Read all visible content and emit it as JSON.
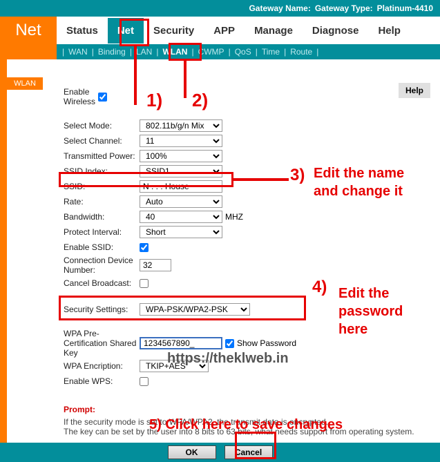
{
  "header": {
    "gateway_name_lbl": "Gateway Name:",
    "gateway_type_lbl": "Gateway Type:",
    "gateway_type_val": "Platinum-4410"
  },
  "brand": "Net",
  "tabs": [
    "Status",
    "Net",
    "Security",
    "APP",
    "Manage",
    "Diagnose",
    "Help"
  ],
  "active_tab": 1,
  "subnav": [
    "WAN",
    "Binding",
    "LAN",
    "WLAN",
    "CWMP",
    "QoS",
    "Time",
    "Route"
  ],
  "active_sub": 3,
  "left_badge": "WLAN",
  "help_button": "Help",
  "form": {
    "enable_wireless_lbl": "Enable Wireless",
    "enable_wireless_val": true,
    "select_mode_lbl": "Select Mode:",
    "select_mode_val": "802.11b/g/n Mix",
    "select_channel_lbl": "Select Channel:",
    "select_channel_val": "11",
    "tx_power_lbl": "Transmitted Power:",
    "tx_power_val": "100%",
    "ssid_index_lbl": "SSID Index:",
    "ssid_index_val": "SSID1",
    "ssid_lbl": "SSID:",
    "ssid_val": "N . . . House",
    "rate_lbl": "Rate:",
    "rate_val": "Auto",
    "bandwidth_lbl": "Bandwidth:",
    "bandwidth_val": "40",
    "bandwidth_unit": "MHZ",
    "protect_lbl": "Protect Interval:",
    "protect_val": "Short",
    "enable_ssid_lbl": "Enable SSID:",
    "enable_ssid_val": true,
    "conn_dev_lbl": "Connection Device Number:",
    "conn_dev_val": "32",
    "cancel_broadcast_lbl": "Cancel Broadcast:",
    "cancel_broadcast_val": false,
    "sec_settings_lbl": "Security Settings:",
    "sec_settings_val": "WPA-PSK/WPA2-PSK",
    "wpa_key_lbl": "WPA Pre-Certification Shared Key",
    "wpa_key_val": "1234567890_",
    "show_pw_lbl": "Show Password",
    "show_pw_val": true,
    "wpa_enc_lbl": "WPA Encription:",
    "wpa_enc_val": "TKIP+AES",
    "enable_wps_lbl": "Enable WPS:",
    "enable_wps_val": false
  },
  "watermark": "https://theklweb.in",
  "prompt": {
    "title": "Prompt:",
    "l1": "  If the security mode is set to WPA/WPA2, the transmit data is encrypted.",
    "l2": "  The key can be set by the user into 8 bits to 63 bits, what needs support from operating system."
  },
  "buttons": {
    "ok": "OK",
    "cancel": "Cancel"
  },
  "annotations": {
    "n1": "1)",
    "n2": "2)",
    "n3_num": "3)",
    "n3_text": "Edit the name and change it",
    "n4_num": "4)",
    "n4_text": "Edit the password here",
    "n5": "5) Click here to save changes"
  }
}
